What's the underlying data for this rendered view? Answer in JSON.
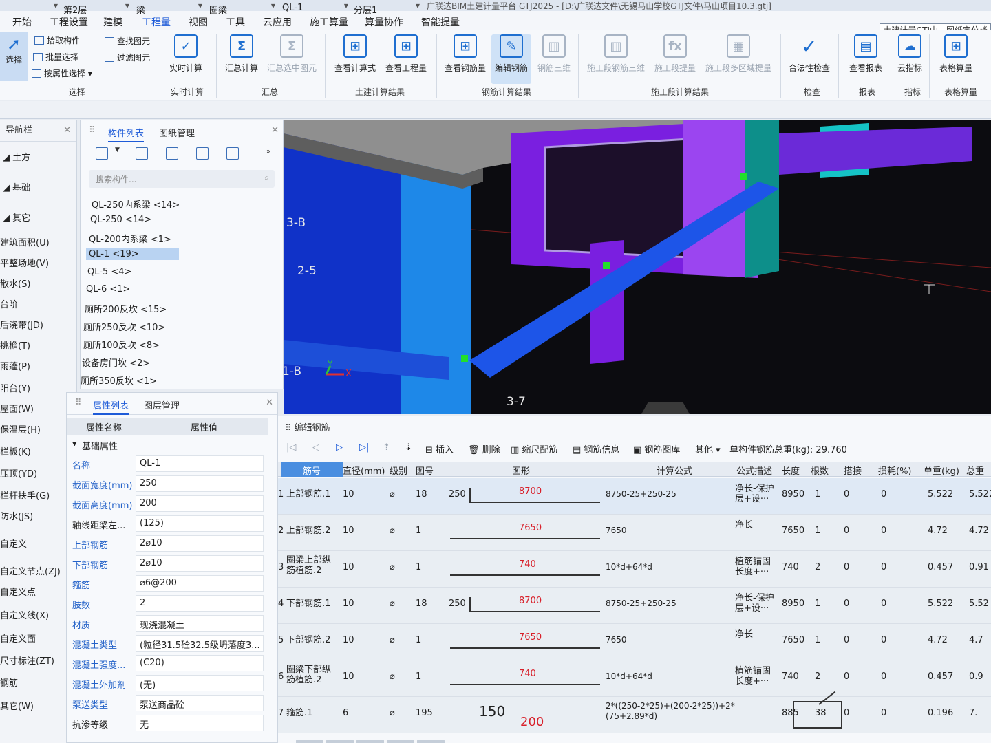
{
  "window": {
    "title": "广联达BIM土建计量平台 GTJ2025 - [D:\\广联达文件\\无锡马山学校GTJ文件\\马山项目10.3.gtj]"
  },
  "menu": {
    "items": [
      "开始",
      "工程设置",
      "建模",
      "工程量",
      "视图",
      "工具",
      "云应用",
      "施工算量",
      "算量协作",
      "智能提量"
    ],
    "active_index": 3,
    "hint": "土建计量GTJ中，图纸定位楼"
  },
  "ribbon": {
    "select_label": "选择",
    "pick_label": "拾取构件",
    "batch_label": "批量选择",
    "attr_select_label": "按属性选择",
    "find_label": "查找图元",
    "filter_label": "过滤图元",
    "realtime_label": "实时计算",
    "summary_calc_label": "汇总计算",
    "summary_selected_label": "汇总选中图元",
    "view_formula_label": "查看计算式",
    "view_quantity_label": "查看工程量",
    "view_rebar_label": "查看钢筋量",
    "edit_rebar_label": "编辑钢筋",
    "rebar_3d_label": "钢筋三维",
    "stage_rebar_3d_label": "施工段钢筋三维",
    "stage_extract_label": "施工段提量",
    "stage_multi_label": "施工段多区域提量",
    "legality_label": "合法性检查",
    "view_report_label": "查看报表",
    "cloud_index_label": "云指标",
    "table_calc_label": "表格算量",
    "groups": {
      "select": "选择",
      "realtime": "实时计算",
      "summary": "汇总",
      "civil": "土建计算结果",
      "rebar": "钢筋计算结果",
      "stage": "施工段计算结果",
      "check": "检查",
      "report": "报表",
      "index": "指标",
      "table": "表格算量"
    }
  },
  "dropdowns": {
    "floor": "第2层",
    "type": "梁",
    "subtype": "圈梁",
    "component": "QL-1",
    "layer": "分层1"
  },
  "nav": {
    "title": "导航栏",
    "categories": [
      "土方",
      "基础",
      "其它"
    ],
    "items": [
      "建筑面积(U)",
      "平整场地(V)",
      "散水(S)",
      "台阶",
      "后浇带(JD)",
      "挑檐(T)",
      "雨蓬(P)",
      "阳台(Y)",
      "屋面(W)",
      "保温层(H)",
      "栏板(K)",
      "压顶(YD)",
      "栏杆扶手(G)",
      "防水(JS)",
      "自定义",
      "自定义节点(ZJ)",
      "自定义点",
      "自定义线(X)",
      "自定义面",
      "尺寸标注(ZT)",
      "钢筋",
      "其它(W)"
    ]
  },
  "component_list": {
    "tab_list": "构件列表",
    "tab_drawing": "图纸管理",
    "search_placeholder": "搜索构件...",
    "items": [
      "QL-250内系梁 <14>",
      "QL-250 <14>",
      "QL-200内系梁 <1>",
      "QL-1 <19>",
      "QL-5 <4>",
      "QL-6 <1>",
      "厕所200反坎 <15>",
      "厕所250反坎 <10>",
      "厕所100反坎 <8>",
      "设备房门坎 <2>",
      "厕所350反坎 <1>"
    ],
    "selected_index": 3
  },
  "properties": {
    "tab_props": "属性列表",
    "tab_layers": "图层管理",
    "col_name": "属性名称",
    "col_value": "属性值",
    "section": "基础属性",
    "rows": [
      {
        "name": "名称",
        "value": "QL-1",
        "highlight": true
      },
      {
        "name": "截面宽度(mm)",
        "value": "250",
        "highlight": true
      },
      {
        "name": "截面高度(mm)",
        "value": "200",
        "highlight": true
      },
      {
        "name": "轴线距梁左...",
        "value": "(125)",
        "highlight": false
      },
      {
        "name": "上部钢筋",
        "value": "2⌀10",
        "highlight": true
      },
      {
        "name": "下部钢筋",
        "value": "2⌀10",
        "highlight": true
      },
      {
        "name": "箍筋",
        "value": "⌀6@200",
        "highlight": true
      },
      {
        "name": "肢数",
        "value": "2",
        "highlight": true
      },
      {
        "name": "材质",
        "value": "现浇混凝土",
        "highlight": true
      },
      {
        "name": "混凝土类型",
        "value": "(粒径31.5砼32.5级坍落度3...",
        "highlight": true
      },
      {
        "name": "混凝土强度...",
        "value": "(C20)",
        "highlight": true
      },
      {
        "name": "混凝土外加剂",
        "value": "(无)",
        "highlight": true
      },
      {
        "name": "泵送类型",
        "value": "泵送商品砼",
        "highlight": true
      },
      {
        "name": "抗渗等级",
        "value": "无",
        "highlight": false
      }
    ]
  },
  "viewport": {
    "labels": [
      "3-B",
      "2-5",
      "1-B",
      "3-7"
    ],
    "axis_x": "X",
    "axis_y": "Y"
  },
  "rebar_editor": {
    "title": "编辑钢筋",
    "toolbar": {
      "insert": "插入",
      "delete": "删除",
      "scale": "缩尺配筋",
      "info": "钢筋信息",
      "library": "钢筋图库",
      "other": "其他",
      "total_weight": "单构件钢筋总重(kg): 29.760"
    },
    "columns": [
      "筋号",
      "直径(mm)",
      "级别",
      "图号",
      "图形",
      "计算公式",
      "公式描述",
      "长度",
      "根数",
      "搭接",
      "损耗(%)",
      "单重(kg)",
      "总重"
    ],
    "rows": [
      {
        "no": "1",
        "name": "上部钢筋.1",
        "diameter": "10",
        "grade": "⌀",
        "fig": "18",
        "shape_left": "250",
        "shape_val": "8700",
        "formula": "8750-25+250-25",
        "desc": "净长-保护层+设···",
        "length": "8950",
        "count": "1",
        "lap": "0",
        "loss": "0",
        "unit_w": "5.522",
        "total_w": "5.522"
      },
      {
        "no": "2",
        "name": "上部钢筋.2",
        "diameter": "10",
        "grade": "⌀",
        "fig": "1",
        "shape_left": "",
        "shape_val": "7650",
        "formula": "7650",
        "desc": "净长",
        "length": "7650",
        "count": "1",
        "lap": "0",
        "loss": "0",
        "unit_w": "4.72",
        "total_w": "4.72"
      },
      {
        "no": "3",
        "name": "圈梁上部纵筋植筋.2",
        "diameter": "10",
        "grade": "⌀",
        "fig": "1",
        "shape_left": "",
        "shape_val": "740",
        "formula": "10*d+64*d",
        "desc": "植筋锚固长度+···",
        "length": "740",
        "count": "2",
        "lap": "0",
        "loss": "0",
        "unit_w": "0.457",
        "total_w": "0.91"
      },
      {
        "no": "4",
        "name": "下部钢筋.1",
        "diameter": "10",
        "grade": "⌀",
        "fig": "18",
        "shape_left": "250",
        "shape_val": "8700",
        "formula": "8750-25+250-25",
        "desc": "净长-保护层+设···",
        "length": "8950",
        "count": "1",
        "lap": "0",
        "loss": "0",
        "unit_w": "5.522",
        "total_w": "5.52"
      },
      {
        "no": "5",
        "name": "下部钢筋.2",
        "diameter": "10",
        "grade": "⌀",
        "fig": "1",
        "shape_left": "",
        "shape_val": "7650",
        "formula": "7650",
        "desc": "净长",
        "length": "7650",
        "count": "1",
        "lap": "0",
        "loss": "0",
        "unit_w": "4.72",
        "total_w": "4.7"
      },
      {
        "no": "6",
        "name": "圈梁下部纵筋植筋.2",
        "diameter": "10",
        "grade": "⌀",
        "fig": "1",
        "shape_left": "",
        "shape_val": "740",
        "formula": "10*d+64*d",
        "desc": "植筋锚固长度+···",
        "length": "740",
        "count": "2",
        "lap": "0",
        "loss": "0",
        "unit_w": "0.457",
        "total_w": "0.9"
      },
      {
        "no": "7",
        "name": "箍筋.1",
        "diameter": "6",
        "grade": "⌀",
        "fig": "195",
        "shape_left": "150",
        "shape_val": "200",
        "formula": "2*((250-2*25)+(200-2*25))+2*(75+2.89*d)",
        "desc": "",
        "length": "885",
        "count": "38",
        "lap": "0",
        "loss": "0",
        "unit_w": "0.196",
        "total_w": "7."
      }
    ]
  },
  "colors": {
    "accent": "#1e5bd8",
    "rebar_value": "#d8202a",
    "header_selected": "#4a8ee0"
  }
}
